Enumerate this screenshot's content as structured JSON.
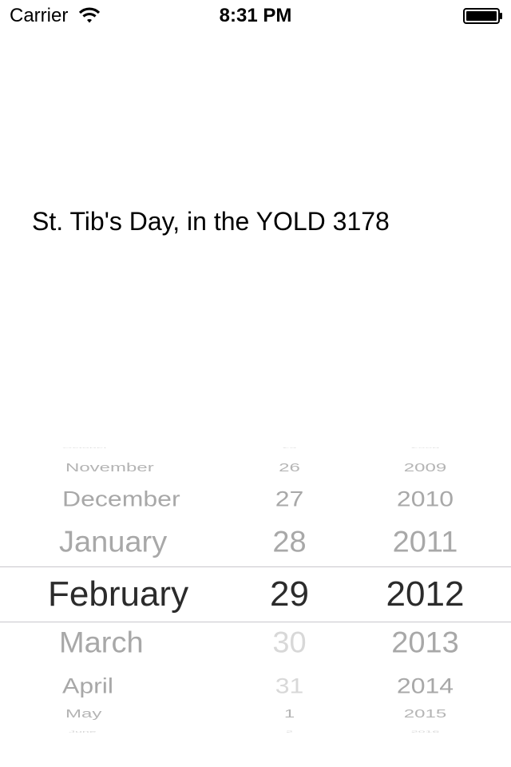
{
  "status_bar": {
    "carrier": "Carrier",
    "time": "8:31 PM",
    "wifi_icon": "wifi-icon",
    "battery_icon": "battery-icon"
  },
  "main": {
    "date_text": "St. Tib's Day, in the YOLD 3178"
  },
  "picker": {
    "months": [
      "October",
      "November",
      "December",
      "January",
      "February",
      "March",
      "April",
      "May",
      "June"
    ],
    "days": [
      "25",
      "26",
      "27",
      "28",
      "29",
      "30",
      "31",
      "1",
      "2"
    ],
    "years": [
      "2008",
      "2009",
      "2010",
      "2011",
      "2012",
      "2013",
      "2014",
      "2015",
      "2016"
    ],
    "selected": {
      "month": "February",
      "day": "29",
      "year": "2012"
    },
    "disabled_day_values": [
      "30",
      "31"
    ],
    "colors": {
      "selected": "#2b2b2b",
      "unselected": "#a8a8a8",
      "disabled": "#d8d8d8",
      "selection_lines": "#c8c7cc"
    }
  }
}
